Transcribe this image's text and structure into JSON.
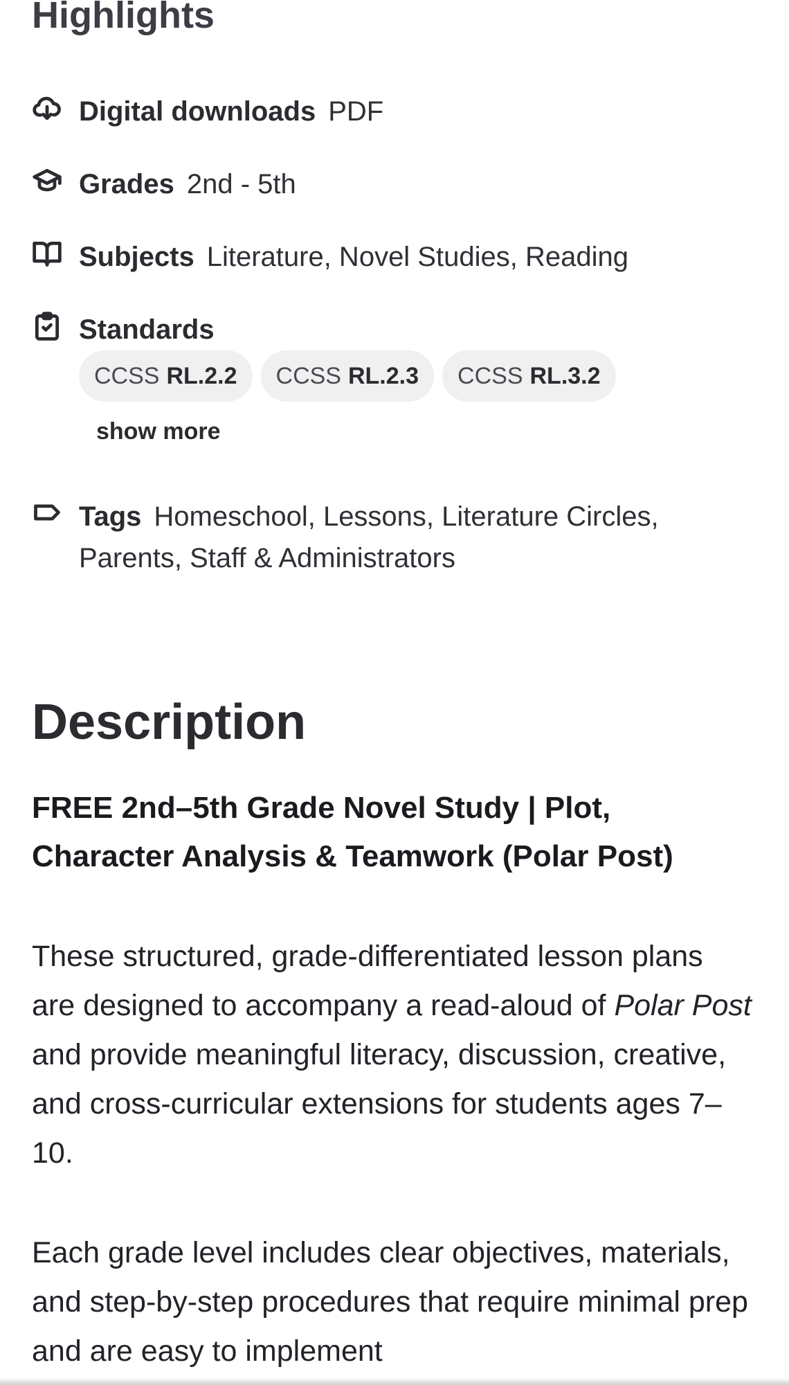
{
  "highlights": {
    "title": "Highlights",
    "digital_downloads": {
      "label": "Digital downloads",
      "value": "PDF",
      "icon": "cloud-download-icon"
    },
    "grades": {
      "label": "Grades",
      "value": "2nd - 5th",
      "icon": "graduation-cap-icon"
    },
    "subjects": {
      "label": "Subjects",
      "value": "Literature, Novel Studies, Reading",
      "icon": "open-book-icon"
    },
    "standards": {
      "label": "Standards",
      "icon": "clipboard-check-icon",
      "chips": [
        {
          "prefix": "CCSS",
          "code": "RL.2.2"
        },
        {
          "prefix": "CCSS",
          "code": "RL.2.3"
        },
        {
          "prefix": "CCSS",
          "code": "RL.3.2"
        }
      ],
      "show_more": "show more"
    },
    "tags": {
      "label": "Tags",
      "value": "Homeschool, Lessons, Literature Circles, Parents, Staff & Administrators",
      "icon": "tag-icon"
    }
  },
  "description": {
    "title": "Description",
    "heading": "FREE 2nd–5th Grade Novel Study | Plot, Character Analysis & Teamwork (Polar Post)",
    "para1": {
      "before": "These structured, grade-differentiated lesson plans are designed to accompany a read-aloud of ",
      "italic": "Polar Post",
      "after": " and provide meaningful literacy, discussion, creative, and cross-curricular extensions for students ages 7–10."
    },
    "para2": "Each grade level includes clear objectives, materials, and step-by-step procedures that require minimal prep and are easy to implement"
  }
}
